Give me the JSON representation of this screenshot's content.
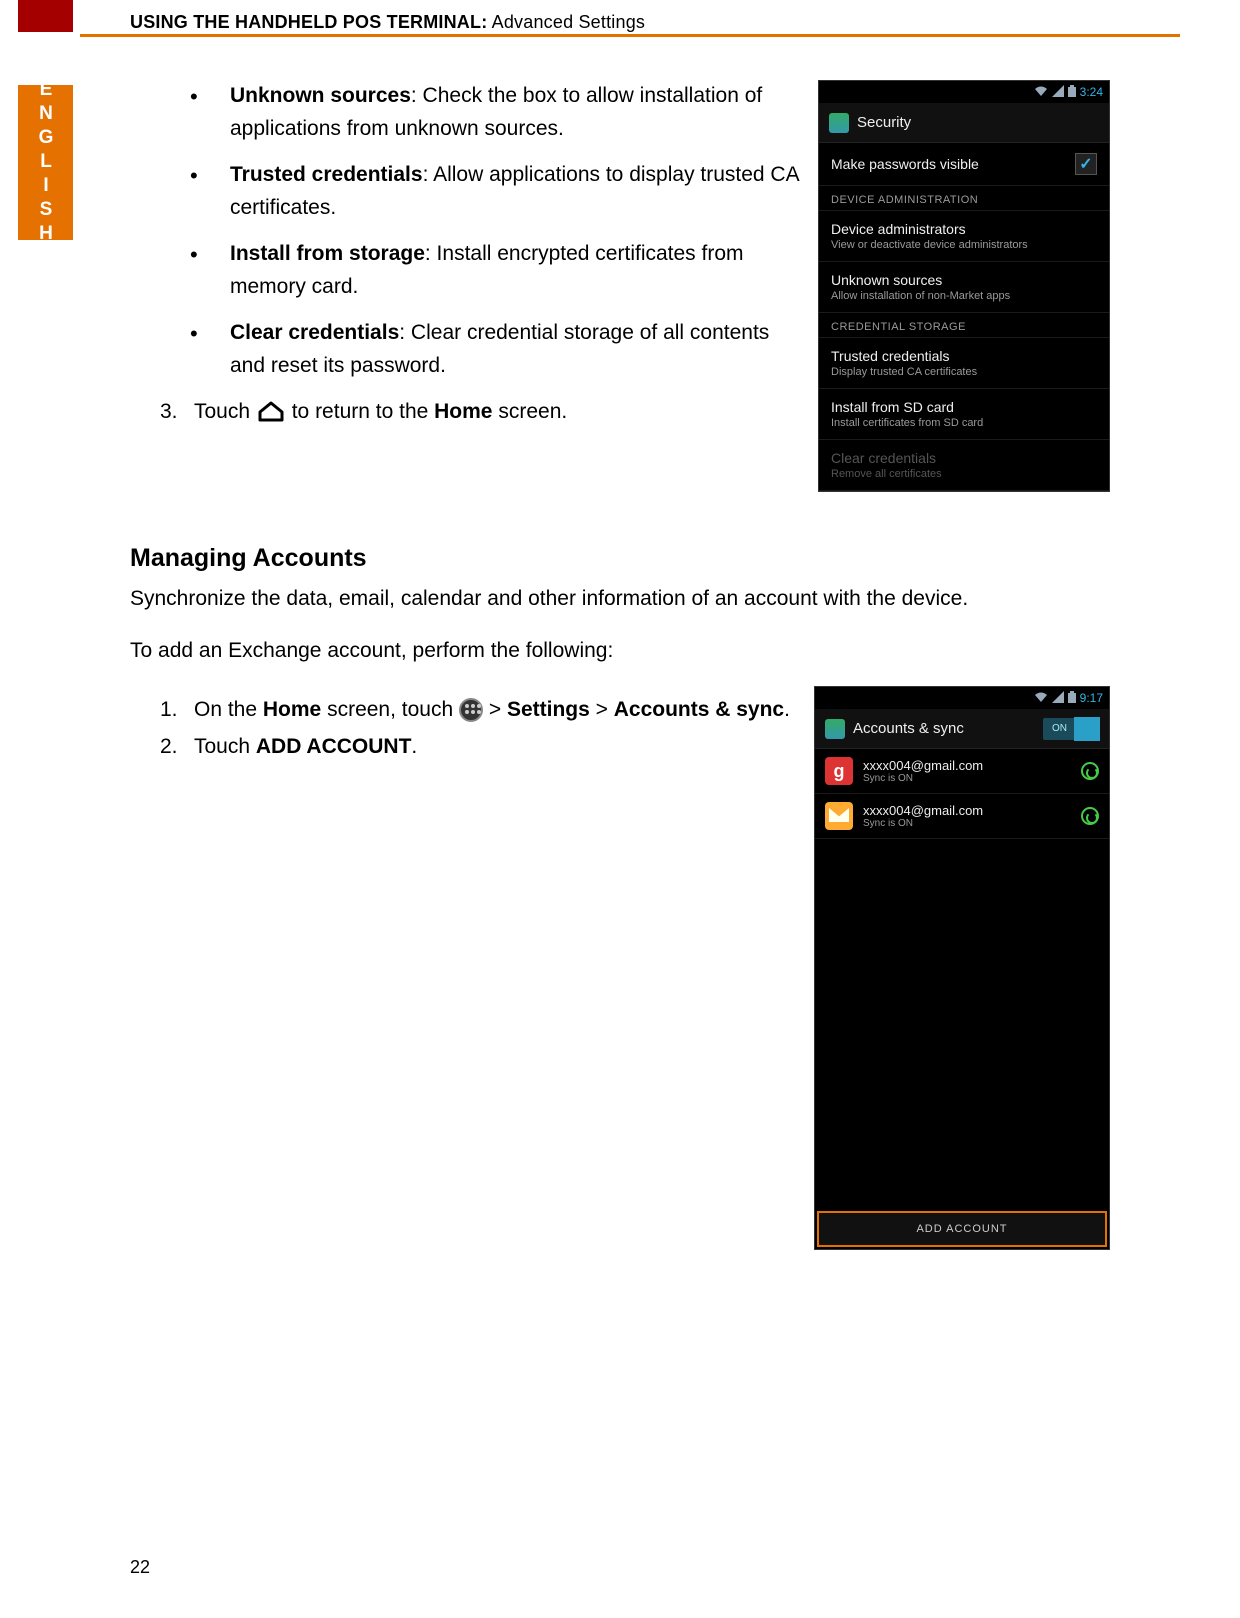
{
  "header": {
    "caps": "USING THE HANDHELD POS TERMINAL:",
    "rest": " Advanced Settings"
  },
  "lang_tab": "ENGLISH",
  "bullets": [
    {
      "term": "Unknown sources",
      "desc": ": Check the box to allow installation of applications from unknown sources."
    },
    {
      "term": "Trusted credentials",
      "desc": ": Allow applications to display trusted CA certificates."
    },
    {
      "term": "Install from storage",
      "desc": ": Install encrypted certificates from memory card."
    },
    {
      "term": "Clear credentials",
      "desc": ": Clear credential storage of all contents and reset its password."
    }
  ],
  "step3": {
    "num": "3.",
    "pre": "Touch ",
    "post": " to return to the ",
    "bold": "Home",
    "end": " screen."
  },
  "section2_title": "Managing Accounts",
  "section2_intro": "Synchronize the data, email, calendar and other information of an account with the device.",
  "section2_lead": "To add an Exchange account, perform the following:",
  "steps2": {
    "s1": {
      "num": "1.",
      "pre": "On the ",
      "b1": "Home",
      "mid": " screen, touch ",
      "gt1": " > ",
      "b2": "Settings",
      "gt2": " > ",
      "b3": "Accounts & sync",
      "end": "."
    },
    "s2": {
      "num": "2.",
      "pre": "Touch ",
      "b1": "ADD ACCOUNT",
      "end": "."
    }
  },
  "phone1": {
    "time": "3:24",
    "title": "Security",
    "row_pwd": "Make passwords visible",
    "cat1": "DEVICE ADMINISTRATION",
    "r1t": "Device administrators",
    "r1s": "View or deactivate device administrators",
    "r2t": "Unknown sources",
    "r2s": "Allow installation of non-Market apps",
    "cat2": "CREDENTIAL STORAGE",
    "r3t": "Trusted credentials",
    "r3s": "Display trusted CA certificates",
    "r4t": "Install from SD card",
    "r4s": "Install certificates from SD card",
    "r5t": "Clear credentials",
    "r5s": "Remove all certificates"
  },
  "phone2": {
    "time": "9:17",
    "title": "Accounts & sync",
    "toggle": "ON",
    "a1t": "xxxx004@gmail.com",
    "a1s": "Sync is ON",
    "a2t": "xxxx004@gmail.com",
    "a2s": "Sync is ON",
    "add": "ADD ACCOUNT"
  },
  "page_num": "22"
}
